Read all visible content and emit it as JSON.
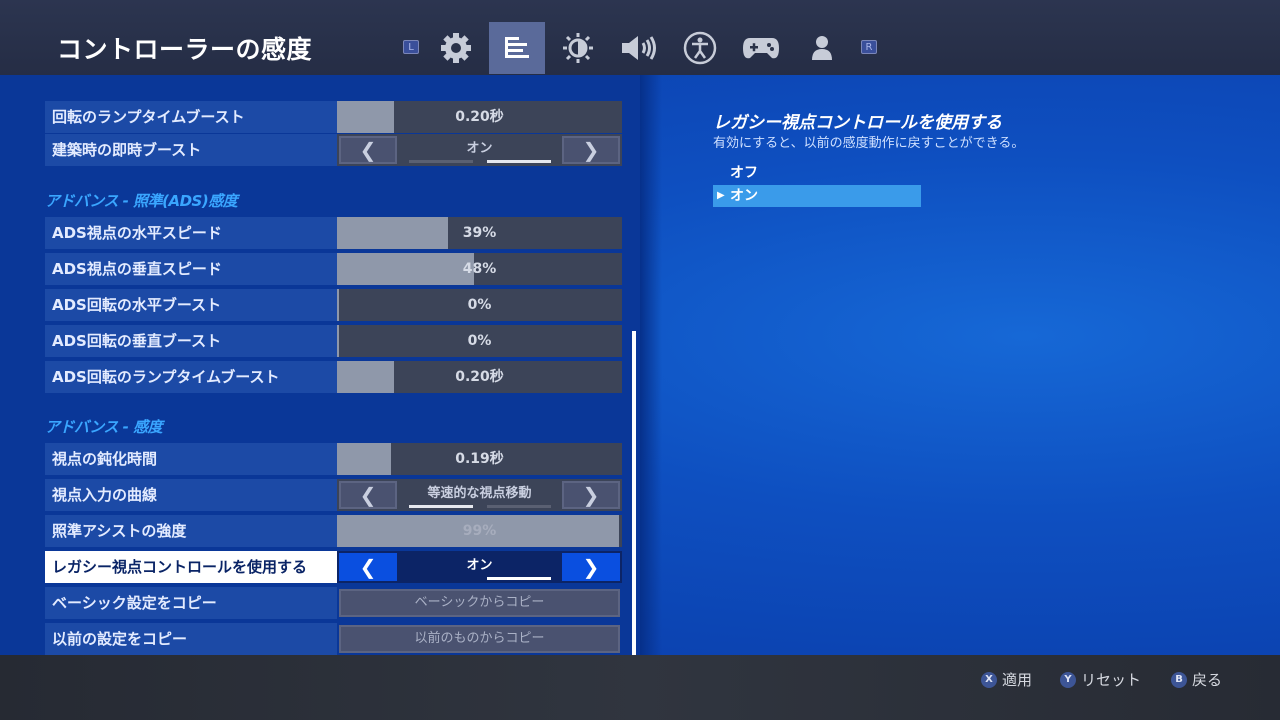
{
  "header": {
    "title": "コントローラーの感度",
    "left_bumper": "L",
    "right_bumper": "R",
    "tabs": [
      {
        "icon": "gear-icon",
        "active": false
      },
      {
        "icon": "controller-settings-list-icon",
        "active": true
      },
      {
        "icon": "brightness-icon",
        "active": false
      },
      {
        "icon": "speaker-icon",
        "active": false
      },
      {
        "icon": "accessibility-icon",
        "active": false
      },
      {
        "icon": "gamepad-icon",
        "active": false
      },
      {
        "icon": "person-icon",
        "active": false
      }
    ]
  },
  "settings": {
    "turn_ramp_boost": {
      "label": "回転のランプタイムブースト",
      "value": "0.20秒",
      "level": 0.2
    },
    "build_instant_boost": {
      "label": "建築時の即時ブースト",
      "value": "オン"
    },
    "section_ads": "アドバンス - 照準(ADS)感度",
    "ads_horizontal": {
      "label": "ADS視点の水平スピード",
      "value": "39%",
      "level": 0.39
    },
    "ads_vertical": {
      "label": "ADS視点の垂直スピード",
      "value": "48%",
      "level": 0.48
    },
    "ads_turn_h_boost": {
      "label": "ADS回転の水平ブースト",
      "value": "0%",
      "level": 0
    },
    "ads_turn_v_boost": {
      "label": "ADS回転の垂直ブースト",
      "value": "0%",
      "level": 0
    },
    "ads_turn_ramp": {
      "label": "ADS回転のランプタイムブースト",
      "value": "0.20秒",
      "level": 0.2
    },
    "section_advanced": "アドバンス - 感度",
    "look_damping": {
      "label": "視点の鈍化時間",
      "value": "0.19秒",
      "level": 0.19
    },
    "look_curve": {
      "label": "視点入力の曲線",
      "value": "等速的な視点移動"
    },
    "aim_assist": {
      "label": "照準アシストの強度",
      "value": "99%",
      "level": 0.99
    },
    "legacy_look": {
      "label": "レガシー視点コントロールを使用する",
      "value": "オン"
    },
    "copy_basic": {
      "label": "ベーシック設定をコピー",
      "button": "ベーシックからコピー"
    },
    "copy_previous": {
      "label": "以前の設定をコピー",
      "button": "以前のものからコピー"
    }
  },
  "detail": {
    "title": "レガシー視点コントロールを使用する",
    "description": "有効にすると、以前の感度動作に戻すことができる。",
    "options": [
      "オフ",
      "オン"
    ],
    "selected": "オン"
  },
  "footer": {
    "apply": {
      "glyph": "X",
      "label": "適用"
    },
    "reset": {
      "glyph": "Y",
      "label": "リセット"
    },
    "back": {
      "glyph": "B",
      "label": "戻る"
    }
  },
  "colors": {
    "accent": "#3aa6ff",
    "panel": "#0a3798",
    "focus": "#0a4fe0"
  }
}
